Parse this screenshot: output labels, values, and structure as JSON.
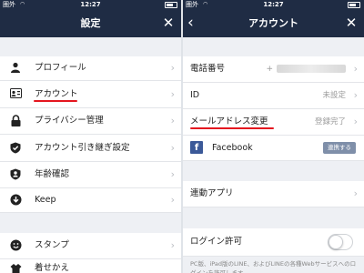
{
  "status": {
    "carrier": "圏外",
    "time": "12:27"
  },
  "left": {
    "title": "設定",
    "items": [
      {
        "label": "プロフィール",
        "icon": "person-icon"
      },
      {
        "label": "アカウント",
        "icon": "id-card-icon"
      },
      {
        "label": "プライバシー管理",
        "icon": "lock-icon"
      },
      {
        "label": "アカウント引き継ぎ設定",
        "icon": "shield-check-icon"
      },
      {
        "label": "年齢確認",
        "icon": "age-shield-icon"
      },
      {
        "label": "Keep",
        "icon": "keep-download-icon"
      },
      {
        "label": "スタンプ",
        "icon": "smile-icon"
      },
      {
        "label": "着せかえ",
        "icon": "theme-icon"
      }
    ]
  },
  "right": {
    "title": "アカウント",
    "phone": {
      "label": "電話番号",
      "prefix": "+"
    },
    "id": {
      "label": "ID",
      "value": "未設定"
    },
    "mail": {
      "label": "メールアドレス変更",
      "value": "登録完了"
    },
    "facebook": {
      "label": "Facebook",
      "button": "連携する"
    },
    "apps": {
      "label": "連動アプリ"
    },
    "login": {
      "label": "ログイン許可",
      "enabled": false
    },
    "note": "PC版、iPad版のLINE、およびLINEの各種Webサービスへのログインを許可します。"
  },
  "colors": {
    "navbar": "#1f2c44",
    "highlight": "#e4161f",
    "facebook": "#3b5998"
  }
}
